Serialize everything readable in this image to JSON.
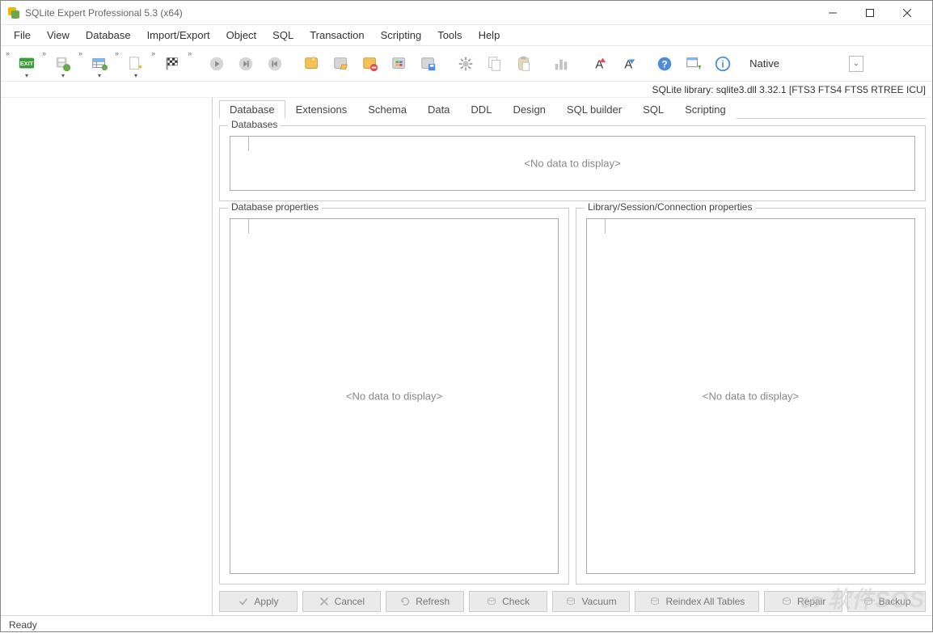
{
  "window": {
    "title": "SQLite Expert Professional 5.3 (x64)"
  },
  "menu": {
    "items": [
      "File",
      "View",
      "Database",
      "Import/Export",
      "Object",
      "SQL",
      "Transaction",
      "Scripting",
      "Tools",
      "Help"
    ]
  },
  "toolbar": {
    "native_label": "Native"
  },
  "infoline": "SQLite library: sqlite3.dll 3.32.1 [FTS3 FTS4 FTS5 RTREE ICU]",
  "tabs": {
    "items": [
      "Database",
      "Extensions",
      "Schema",
      "Data",
      "DDL",
      "Design",
      "SQL builder",
      "SQL",
      "Scripting"
    ],
    "active": 0
  },
  "panels": {
    "databases_legend": "Databases",
    "db_props_legend": "Database properties",
    "lib_props_legend": "Library/Session/Connection properties",
    "nodata": "<No data to display>"
  },
  "buttons": {
    "apply": "Apply",
    "cancel": "Cancel",
    "refresh": "Refresh",
    "check": "Check",
    "vacuum": "Vacuum",
    "reindex": "Reindex All Tables",
    "repair": "Repair",
    "backup": "Backup"
  },
  "status": {
    "text": "Ready"
  },
  "watermark": "软件SOS"
}
